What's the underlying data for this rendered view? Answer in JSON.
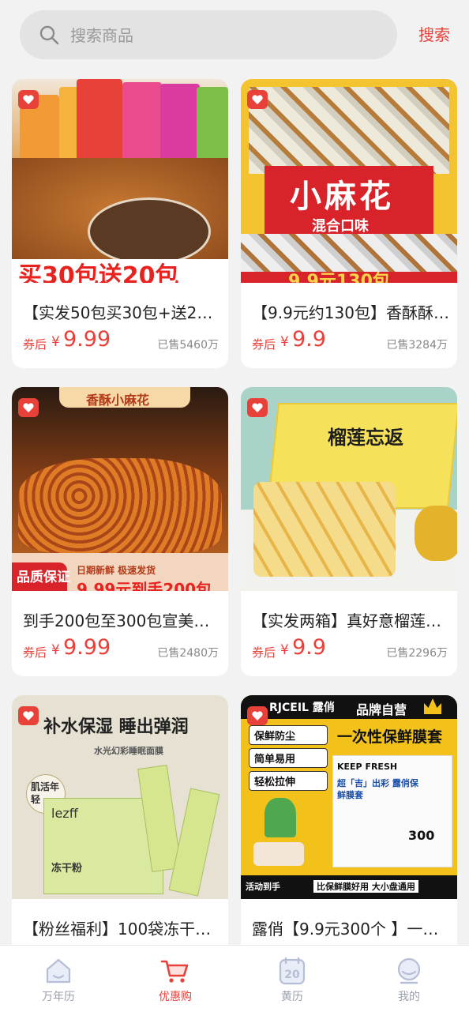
{
  "search": {
    "placeholder": "搜索商品",
    "button_label": "搜索"
  },
  "products": [
    {
      "title": "【实发50包买30包+送20…",
      "coupon_label": "券后",
      "currency": "¥",
      "price": "9.99",
      "sold": "已售5460万",
      "banner": "买30包送20包",
      "bg": "#d98a3c"
    },
    {
      "title": "【9.9元约130包】香酥酥…",
      "coupon_label": "券后",
      "currency": "¥",
      "price": "9.9",
      "sold": "已售3284万",
      "banner_main": "小麻花",
      "banner_sub": "混合口味",
      "banner_bottom": "9.9元130包",
      "bg": "#f3c330"
    },
    {
      "title": "到手200包至300包宣美…",
      "coupon_label": "券后",
      "currency": "¥",
      "price": "9.99",
      "sold": "已售2480万",
      "banner_top": "香酥小麻花",
      "banner_left": "品质保证",
      "banner_strip": "日期新鲜 极速发货",
      "banner_bottom": "9.99元到手200包",
      "bg": "#c96a24"
    },
    {
      "title": "【实发两箱】真好意榴莲…",
      "coupon_label": "券后",
      "currency": "¥",
      "price": "9.9",
      "sold": "已售2296万",
      "banner": "榴莲忘返",
      "bg": "#a9d3c8"
    },
    {
      "title": "【粉丝福利】100袋冻干…",
      "banner_top": "补水保湿 睡出弹润",
      "banner_sub": "水光幻彩睡眠面膜",
      "banner_left": "肌活年轻",
      "brand": "lezff",
      "box_label": "冻干粉",
      "bg": "#ddd8c8"
    },
    {
      "title": "露俏【9.9元300个 】一…",
      "brand": "RJCEIL 露俏",
      "banner_top": "品牌自营",
      "banner_main": "一次性保鲜膜套",
      "features": [
        "保鲜防尘",
        "简单易用",
        "轻松拉伸"
      ],
      "package_title": "超「吉」出彩 露俏保鲜膜套",
      "keep_fresh": "KEEP FRESH",
      "count": "300",
      "strip_left": "活动到手",
      "strip_right": "比保鲜膜好用 大小盘通用",
      "bg": "#f2c21b"
    }
  ],
  "tabs": [
    {
      "label": "万年历",
      "icon": "home-icon",
      "active": false
    },
    {
      "label": "优惠购",
      "icon": "cart-icon",
      "active": true
    },
    {
      "label": "黄历",
      "icon": "calendar-icon",
      "active": false,
      "icon_text": "20"
    },
    {
      "label": "我的",
      "icon": "profile-icon",
      "active": false
    }
  ],
  "colors": {
    "accent": "#e8413a",
    "inactive_tab": "#9aa0ad",
    "background": "#f2f2f2"
  }
}
